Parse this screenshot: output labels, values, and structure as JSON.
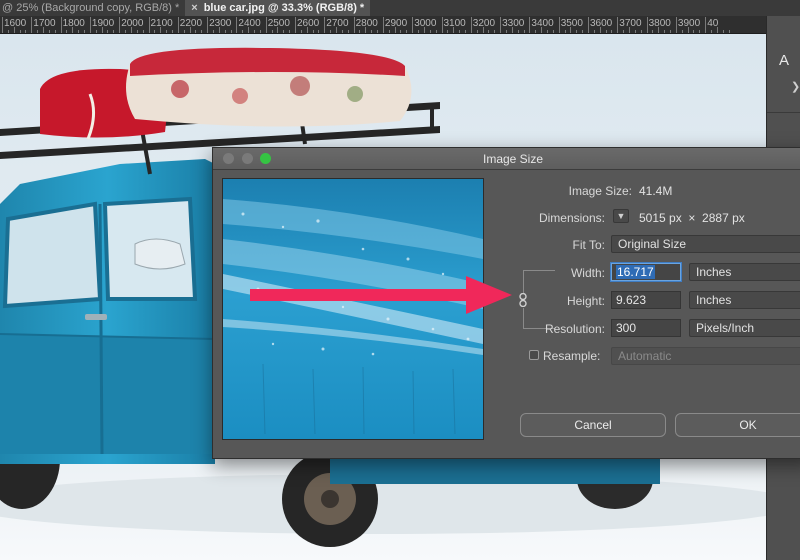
{
  "tabs": [
    {
      "title": "@ 25% (Background copy, RGB/8) *",
      "active": false
    },
    {
      "title": "blue car.jpg @ 33.3% (RGB/8) *",
      "active": true
    }
  ],
  "tab_close_glyph": "×",
  "ruler": {
    "labels": [
      "1600",
      "1700",
      "1800",
      "1900",
      "2000",
      "2100",
      "2200",
      "2300",
      "2400",
      "2500",
      "2600",
      "2700",
      "2800",
      "2900",
      "3000",
      "3100",
      "3200",
      "3300",
      "3400",
      "3500",
      "3600",
      "3700",
      "3800",
      "3900",
      "40"
    ]
  },
  "panel": {
    "letter": "A",
    "chevron": "❯"
  },
  "dialog": {
    "title": "Image Size",
    "image_size_label": "Image Size:",
    "image_size_value": "41.4M",
    "dimensions_label": "Dimensions:",
    "dimensions_value": "5015 px  ×  2887 px",
    "fit_to_label": "Fit To:",
    "fit_to_value": "Original Size",
    "width_label": "Width:",
    "width_value": "16.717",
    "width_unit": "Inches",
    "height_label": "Height:",
    "height_value": "9.623",
    "height_unit": "Inches",
    "resolution_label": "Resolution:",
    "resolution_value": "300",
    "resolution_unit": "Pixels/Inch",
    "resample_label": "Resample:",
    "resample_checked": false,
    "resample_value": "Automatic",
    "cancel_label": "Cancel",
    "ok_label": "OK"
  },
  "colors": {
    "arrow": "#f0285a",
    "car_blue": "#2aa4cf",
    "dialog_bg": "#575757",
    "maximize_green": "#35c443",
    "selection_blue": "#2f6cb5"
  }
}
